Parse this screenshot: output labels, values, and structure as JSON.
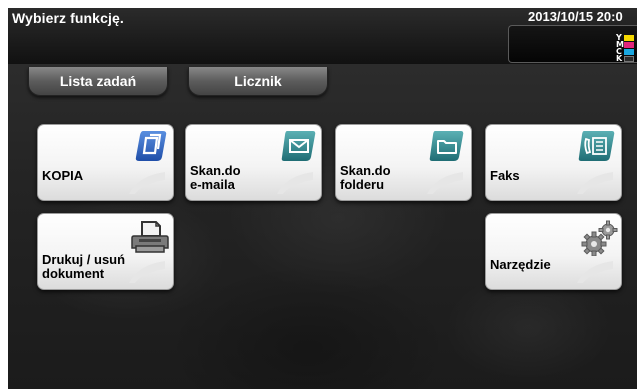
{
  "header": {
    "title": "Wybierz funkcję.",
    "datetime": "2013/10/15 20:0",
    "toner": [
      {
        "letter": "Y",
        "color": "#f5d800"
      },
      {
        "letter": "M",
        "color": "#e0247a"
      },
      {
        "letter": "C",
        "color": "#1aa7e0"
      },
      {
        "letter": "K",
        "color": "#2a2a2a"
      }
    ]
  },
  "top_buttons": {
    "job_list": "Lista zadań",
    "counter": "Licznik"
  },
  "tiles": {
    "copy": {
      "label": "KOPIA",
      "icon": "copy-icon"
    },
    "scan_email": {
      "label": "Skan.do\ne-maila",
      "icon": "envelope-icon"
    },
    "scan_folder": {
      "label": "Skan.do\nfolderu",
      "icon": "folder-icon"
    },
    "fax": {
      "label": "Faks",
      "icon": "fax-icon"
    },
    "print": {
      "label": "Drukuj / usuń\ndokument",
      "icon": "printer-icon"
    },
    "utility": {
      "label": "Narzędzie",
      "icon": "gears-icon"
    }
  }
}
